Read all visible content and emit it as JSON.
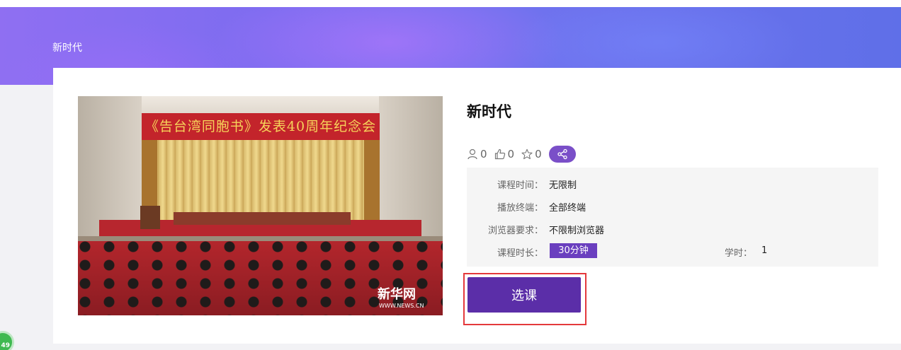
{
  "breadcrumb": {
    "current": "新时代"
  },
  "course": {
    "title": "新时代",
    "image": {
      "banner_text": "《告台湾同胞书》发表40周年纪念会",
      "watermark": "新华网",
      "watermark_sub": "WWW.NEWS.CN"
    },
    "stats": {
      "learners": "0",
      "likes": "0",
      "favorites": "0"
    },
    "details": {
      "course_time_label": "课程时间：",
      "course_time_value": "无限制",
      "terminal_label": "播放终端：",
      "terminal_value": "全部终端",
      "browser_label": "浏览器要求：",
      "browser_value": "不限制浏览器",
      "duration_label": "课程时长：",
      "duration_value": "30分钟",
      "credit_label": "学时：",
      "credit_value": "1"
    },
    "enroll_label": "选课"
  },
  "corner_badge": "49",
  "colors": {
    "accent": "#5b2ea8",
    "badge": "#6a3fbf",
    "highlight": "#e4393c",
    "banner_start": "#8f6ff2",
    "banner_end": "#5f6fe8"
  }
}
